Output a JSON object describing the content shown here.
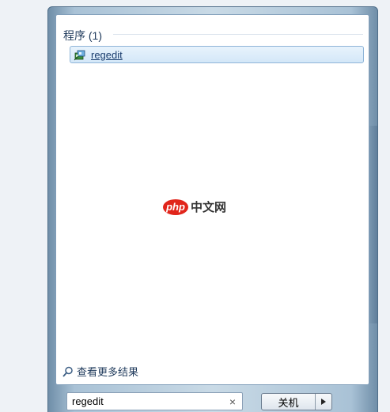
{
  "results": {
    "section_header": "程序 (1)",
    "items": [
      {
        "label": "regedit",
        "icon": "regedit-icon"
      }
    ],
    "see_more_label": "查看更多结果"
  },
  "watermark": {
    "badge_text": "php",
    "text": "中文网"
  },
  "search": {
    "value": "regedit",
    "clear_icon": "close-icon"
  },
  "power": {
    "shutdown_label": "关机",
    "arrow_icon": "triangle-right-icon"
  },
  "colors": {
    "accent": "#1e395b",
    "selection": "#d3e7f8",
    "logo_red": "#e1251b"
  }
}
